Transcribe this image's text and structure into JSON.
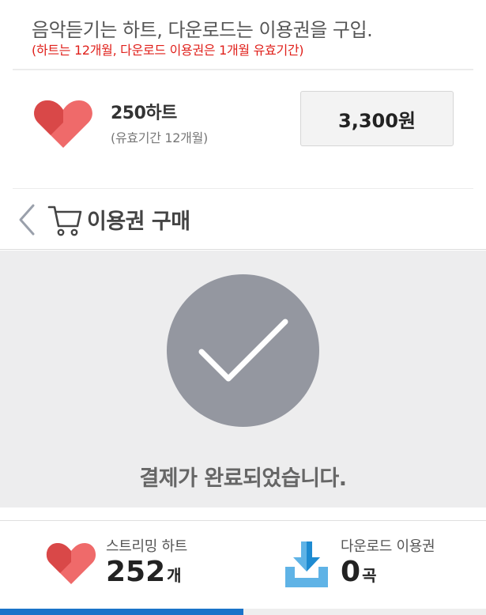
{
  "banner": {
    "title": "음악듣기는 하트, 다운로드는 이용권을 구입.",
    "note": "(하트는 12개월, 다운로드 이용권은 1개월 유효기간)"
  },
  "offer": {
    "name": "250하트",
    "period": "(유효기간 12개월)",
    "price": "3,300원",
    "icon": "heart-icon"
  },
  "header": {
    "title": "이용권 구매",
    "back_icon": "chevron-left-icon",
    "cart_icon": "cart-icon"
  },
  "main": {
    "status_icon": "checkmark-icon",
    "message": "결제가 완료되었습니다."
  },
  "footer": {
    "streaming": {
      "label": "스트리밍 하트",
      "count": "252",
      "unit": "개"
    },
    "download": {
      "label": "다운로드 이용권",
      "count": "0",
      "unit": "곡"
    },
    "active_tab_fraction": 0.5
  },
  "colors": {
    "heart": "#ef6a6a",
    "heart_dark": "#d94848",
    "check_circle": "#9497a0",
    "accent_blue": "#1a73c9",
    "note_red": "#e0201b",
    "download_light": "#5fb3e6",
    "download_dark": "#1e8bd1"
  }
}
